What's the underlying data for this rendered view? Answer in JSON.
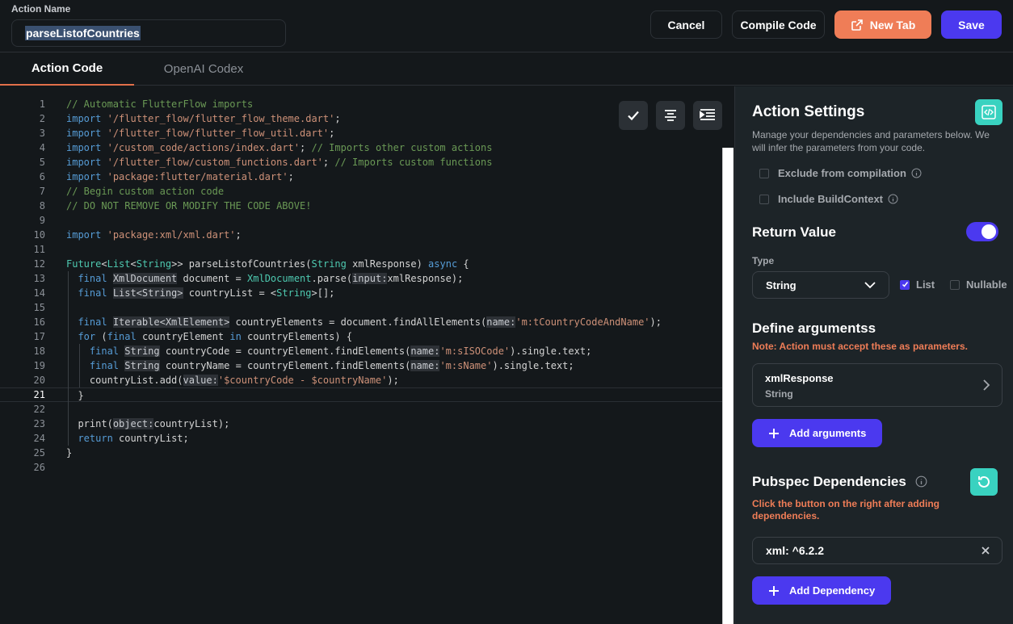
{
  "header": {
    "action_name_label": "Action Name",
    "action_name_value": "parseListofCountries",
    "cancel_label": "Cancel",
    "compile_label": "Compile Code",
    "new_tab_label": "New Tab",
    "save_label": "Save"
  },
  "tabs": [
    {
      "label": "Action Code",
      "active": true
    },
    {
      "label": "OpenAI Codex",
      "active": false
    }
  ],
  "editor": {
    "current_line": 21,
    "line_numbers": [
      "1",
      "2",
      "3",
      "4",
      "5",
      "6",
      "7",
      "8",
      "9",
      "10",
      "11",
      "12",
      "13",
      "14",
      "15",
      "16",
      "17",
      "18",
      "19",
      "20",
      "21",
      "22",
      "23",
      "24",
      "25",
      "26"
    ],
    "toolbar_icons": [
      "check-icon",
      "format-align-icon",
      "indent-icon"
    ]
  },
  "code": {
    "l1": "// Automatic FlutterFlow imports",
    "l2a": "import",
    "l2b": "'/flutter_flow/flutter_flow_theme.dart'",
    "l3a": "import",
    "l3b": "'/flutter_flow/flutter_flow_util.dart'",
    "l4a": "import",
    "l4b": "'/custom_code/actions/index.dart'",
    "l4c": "// Imports other custom actions",
    "l5a": "import",
    "l5b": "'/flutter_flow/custom_functions.dart'",
    "l5c": "// Imports custom functions",
    "l6a": "import",
    "l6b": "'package:flutter/material.dart'",
    "l7": "// Begin custom action code",
    "l8": "// DO NOT REMOVE OR MODIFY THE CODE ABOVE!",
    "l10a": "import",
    "l10b": "'package:xml/xml.dart'",
    "l12_future": "Future",
    "l12_list": "List",
    "l12_string": "String",
    "l12_name": "parseListofCountries",
    "l12_string2": "String",
    "l12_param": "xmlResponse",
    "l12_async": "async",
    "l13_final": "final",
    "l13_type": "XmlDocument",
    "l13_var": "document",
    "l13_cls": "XmlDocument",
    "l13_call": ".parse(",
    "l13_hint": "input:",
    "l13_rest": "xmlResponse);",
    "l14_final": "final",
    "l14_type": "List<String>",
    "l14_var": "countryList",
    "l14_str": "String",
    "l16_final": "final",
    "l16_type": "Iterable<XmlElement>",
    "l16_var": "countryElements",
    "l16_call": "document.findAllElements(",
    "l16_hint": "name:",
    "l16_str": "'m:tCountryCodeAndName'",
    "l17_for": "for",
    "l17_final": "final",
    "l17_var": "countryElement",
    "l17_in": "in",
    "l17_rest": "countryElements) {",
    "l18_final": "final",
    "l18_type": "String",
    "l18_var": "countryCode",
    "l18_call": "countryElement.findElements(",
    "l18_hint": "name:",
    "l18_str": "'m:sISOCode'",
    "l18_rest": ").single.text;",
    "l19_final": "final",
    "l19_type": "String",
    "l19_var": "countryName",
    "l19_call": "countryElement.findElements(",
    "l19_hint": "name:",
    "l19_str": "'m:sName'",
    "l19_rest": ").single.text;",
    "l20_call": "countryList.add(",
    "l20_hint": "value:",
    "l20_str": "'$countryCode - $countryName'",
    "l21": "}",
    "l23_call": "print(",
    "l23_hint": "object:",
    "l23_rest": "countryList);",
    "l24_kw": "return",
    "l24_rest": "countryList;",
    "l25": "}"
  },
  "panel": {
    "title": "Action Settings",
    "description": "Manage your dependencies and parameters below. We will infer the parameters from your code.",
    "exclude_label": "Exclude from compilation",
    "include_context_label": "Include BuildContext",
    "return_value_title": "Return Value",
    "return_value_enabled": true,
    "type_label": "Type",
    "type_value": "String",
    "list_label": "List",
    "list_checked": true,
    "nullable_label": "Nullable",
    "nullable_checked": false,
    "arguments_title": "Define argumentss",
    "arguments_note": "Note: Action must accept these as parameters.",
    "argument_name": "xmlResponse",
    "argument_type": "String",
    "add_arguments_label": "Add arguments",
    "pubspec_title": "Pubspec Dependencies",
    "pubspec_note": "Click the button on the right after adding dependencies.",
    "dependency_value": "xml: ^6.2.2",
    "add_dependency_label": "Add Dependency"
  },
  "colors": {
    "accent": "#4b39ef",
    "orange": "#ef7d57",
    "teal": "#39d2c0",
    "background": "#14181b",
    "panel": "#1d2428"
  }
}
